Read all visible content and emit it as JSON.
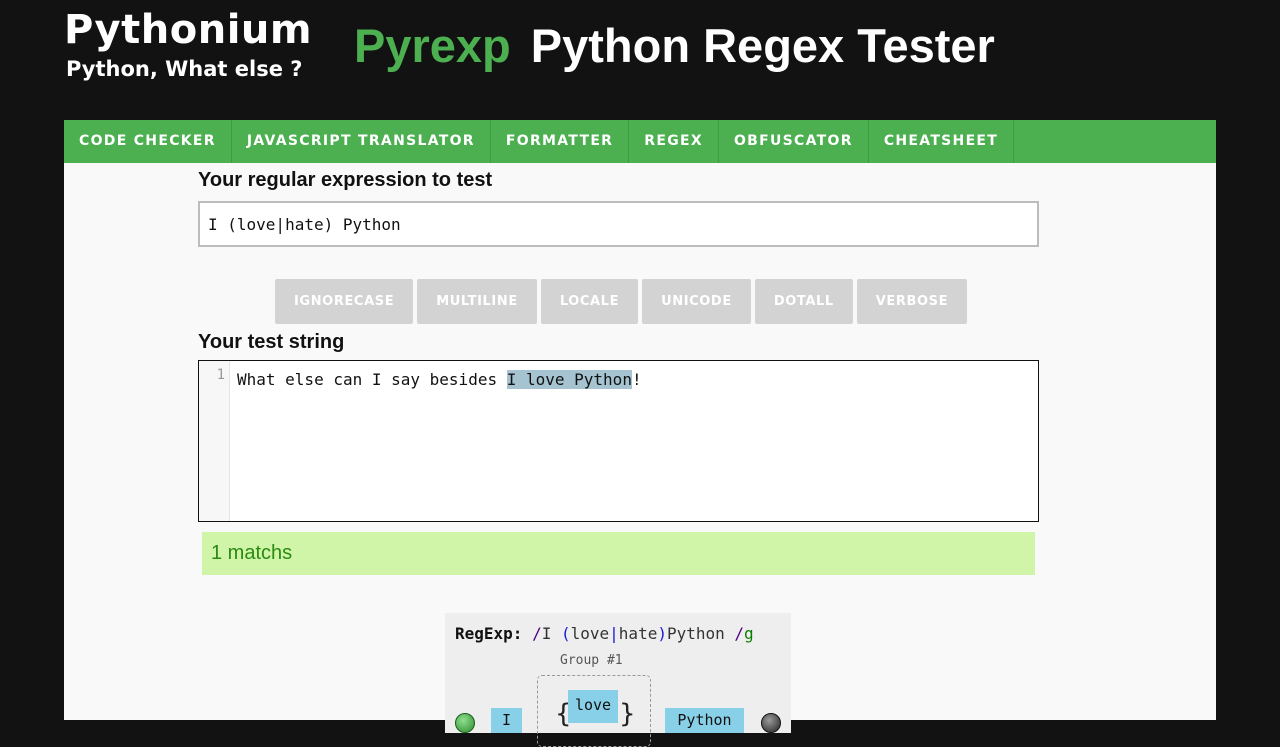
{
  "header": {
    "site_name": "Pythonium",
    "tagline": "Python, What else ?",
    "title_accent": "Pyrexp",
    "title_rest": "Python Regex Tester",
    "accent_color": "#4caf50"
  },
  "nav": {
    "items": [
      {
        "label": "CODE CHECKER"
      },
      {
        "label": "JAVASCRIPT TRANSLATOR"
      },
      {
        "label": "FORMATTER"
      },
      {
        "label": "REGEX"
      },
      {
        "label": "OBFUSCATOR"
      },
      {
        "label": "CHEATSHEET"
      }
    ]
  },
  "regex": {
    "label": "Your regular expression to test",
    "value": "I (love|hate) Python"
  },
  "flags": [
    "IGNORECASE",
    "MULTILINE",
    "LOCALE",
    "UNICODE",
    "DOTALL",
    "VERBOSE"
  ],
  "test": {
    "label": "Your test string",
    "line_number": "1",
    "before_match": "What else can I say besides ",
    "match": "I love Python",
    "after_match": "!"
  },
  "result": {
    "text": "1 matchs"
  },
  "railroad": {
    "label": "RegExp:",
    "slash_open": "/",
    "part_I": "I ",
    "paren_open": "(",
    "alt1": "love",
    "pipe": "|",
    "alt2": "hate",
    "paren_close": ")",
    "part_python": "Python ",
    "slash_close": "/",
    "flag": "g",
    "group_label": "Group #1",
    "node_I": "I",
    "node_love": "love",
    "node_python": "Python"
  }
}
